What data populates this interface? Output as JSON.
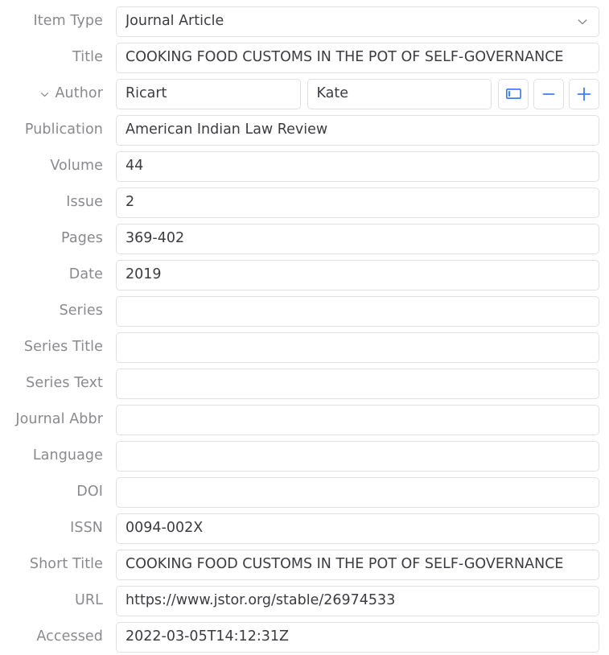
{
  "pane": {
    "name": "item-metadata-editor",
    "accent_color": "#3b7ff0",
    "label_color": "#8a8a8e",
    "value_color": "#3c3c41",
    "border_color": "#e0e0e0",
    "background": "#ffffff"
  },
  "item_type": {
    "label": "Item Type",
    "value": "Journal Article",
    "dropdown_icon": "chevron-down-icon"
  },
  "creator": {
    "label": "Author",
    "twisty_icon": "chevron-down-icon",
    "last_name": "Ricart",
    "first_name": "Kate",
    "buttons": [
      {
        "name": "switch-to-single-field-button",
        "icon": "single-field-icon",
        "label": ""
      },
      {
        "name": "remove-creator-button",
        "icon": "minus-icon",
        "label": "−"
      },
      {
        "name": "add-creator-button",
        "icon": "plus-icon",
        "label": "+"
      }
    ]
  },
  "fields": [
    {
      "label": "Title",
      "value": "COOKING FOOD CUSTOMS IN THE POT OF SELF-GOVERNANCE",
      "name": "title"
    },
    {
      "label": "Publication",
      "value": "American Indian Law Review",
      "name": "publication"
    },
    {
      "label": "Volume",
      "value": "44",
      "name": "volume"
    },
    {
      "label": "Issue",
      "value": "2",
      "name": "issue"
    },
    {
      "label": "Pages",
      "value": "369-402",
      "name": "pages"
    },
    {
      "label": "Date",
      "value": "2019",
      "name": "date"
    },
    {
      "label": "Series",
      "value": "",
      "name": "series"
    },
    {
      "label": "Series Title",
      "value": "",
      "name": "series-title"
    },
    {
      "label": "Series Text",
      "value": "",
      "name": "series-text"
    },
    {
      "label": "Journal Abbr",
      "value": "",
      "name": "journal-abbr"
    },
    {
      "label": "Language",
      "value": "",
      "name": "language"
    },
    {
      "label": "DOI",
      "value": "",
      "name": "doi"
    },
    {
      "label": "ISSN",
      "value": "0094-002X",
      "name": "issn"
    },
    {
      "label": "Short Title",
      "value": "COOKING FOOD CUSTOMS IN THE POT OF SELF-GOVERNANCE",
      "name": "short-title"
    },
    {
      "label": "URL",
      "value": "https://www.jstor.org/stable/26974533",
      "name": "url"
    },
    {
      "label": "Accessed",
      "value": "2022-03-05T14:12:31Z",
      "name": "accessed"
    }
  ]
}
